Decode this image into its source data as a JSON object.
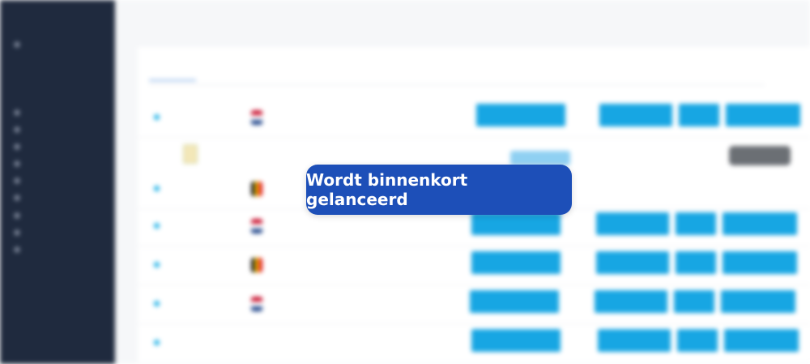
{
  "overlay": {
    "message": "Wordt binnenkort gelanceerd"
  },
  "colors": {
    "overlay_bg": "#1d4fb8",
    "accent": "#17a6e3",
    "sidebar_bg": "#1f2a3e"
  }
}
